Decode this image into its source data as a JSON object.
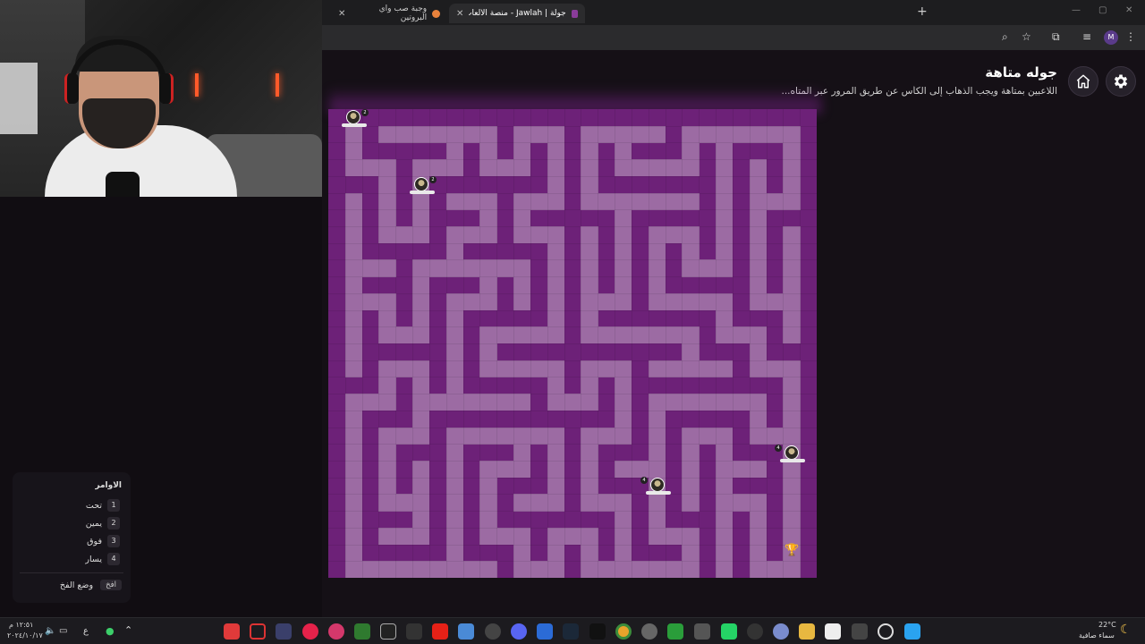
{
  "browser": {
    "tabs": [
      {
        "title": "وجبة صب واي البروتين"
      },
      {
        "title": "جولة | Jawlah - منصة الألعاب ال...",
        "active": true
      }
    ],
    "profile_initial": "M"
  },
  "page": {
    "title": "جوله متاهة",
    "subtitle": "اللاعبين بمتاهة ويجب الذهاب إلى الكأس عن طريق المرور عبر المتاه..."
  },
  "commands": {
    "title": "الاوامر",
    "items": [
      {
        "key": "1",
        "label": "تحت"
      },
      {
        "key": "2",
        "label": "يمين"
      },
      {
        "key": "3",
        "label": "فوق"
      },
      {
        "key": "4",
        "label": "يسار"
      }
    ],
    "trap_label": "وضع الفخ",
    "trap_key": "افخ"
  },
  "taskbar": {
    "weather_temp": "22°C",
    "weather_desc": "سماء صافية",
    "time": "١٢:٥١ م",
    "date": "٢٠٢٤/١٠/١٧",
    "lang": "ع"
  },
  "colors": {
    "wall": "#6d2178",
    "path": "#9c6ba3",
    "accent": "#8a3c9a"
  },
  "icons": {
    "home": "home-icon",
    "settings": "gear-icon",
    "trophy": "trophy-icon"
  }
}
